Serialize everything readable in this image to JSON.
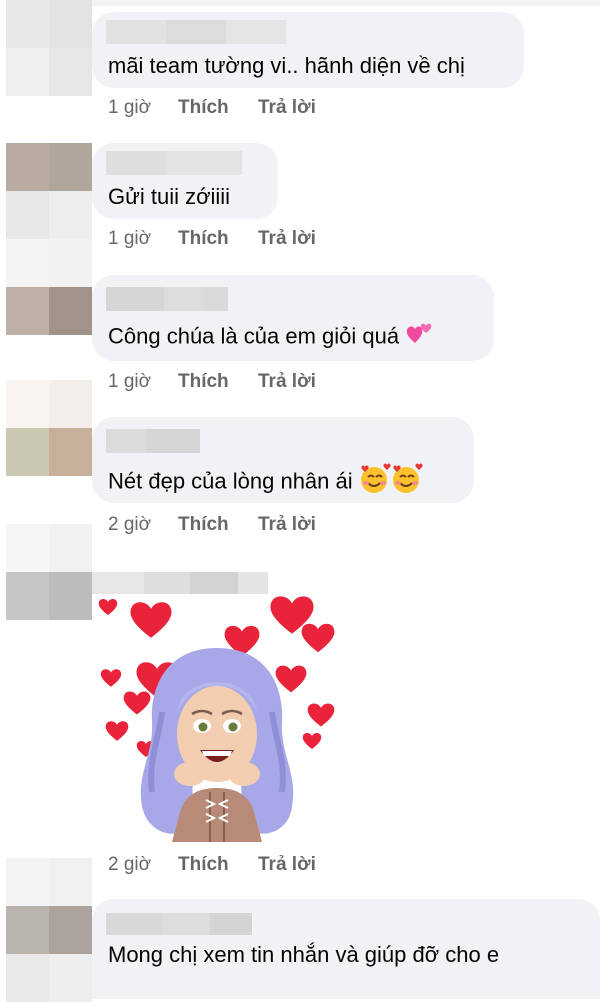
{
  "comments": [
    {
      "text": "mãi team tường vi.. hãnh diện về chị",
      "time": "1 giờ",
      "like": "Thích",
      "reply": "Trả lời"
    },
    {
      "text": "Gửi tuii zớiiii",
      "time": "1 giờ",
      "like": "Thích",
      "reply": "Trả lời"
    },
    {
      "text": "Công chúa là của em giỏi quá",
      "emoji": "heart-emoji",
      "time": "1 giờ",
      "like": "Thích",
      "reply": "Trả lời"
    },
    {
      "text": "Nét đẹp của lòng nhân ái",
      "emoji": "smiling-face-with-hearts-emoji",
      "time": "2 giờ",
      "like": "Thích",
      "reply": "Trả lời"
    },
    {
      "sticker": "avatar-sticker-with-hearts",
      "time": "2 giờ",
      "like": "Thích",
      "reply": "Trả lời"
    },
    {
      "text": "Mong chị xem tin nhắn và giúp đỡ cho e"
    }
  ],
  "colors": {
    "bubble": "#f0f2f5",
    "meta_text": "#65676b",
    "text": "#050505",
    "heart": "#e8233a"
  }
}
